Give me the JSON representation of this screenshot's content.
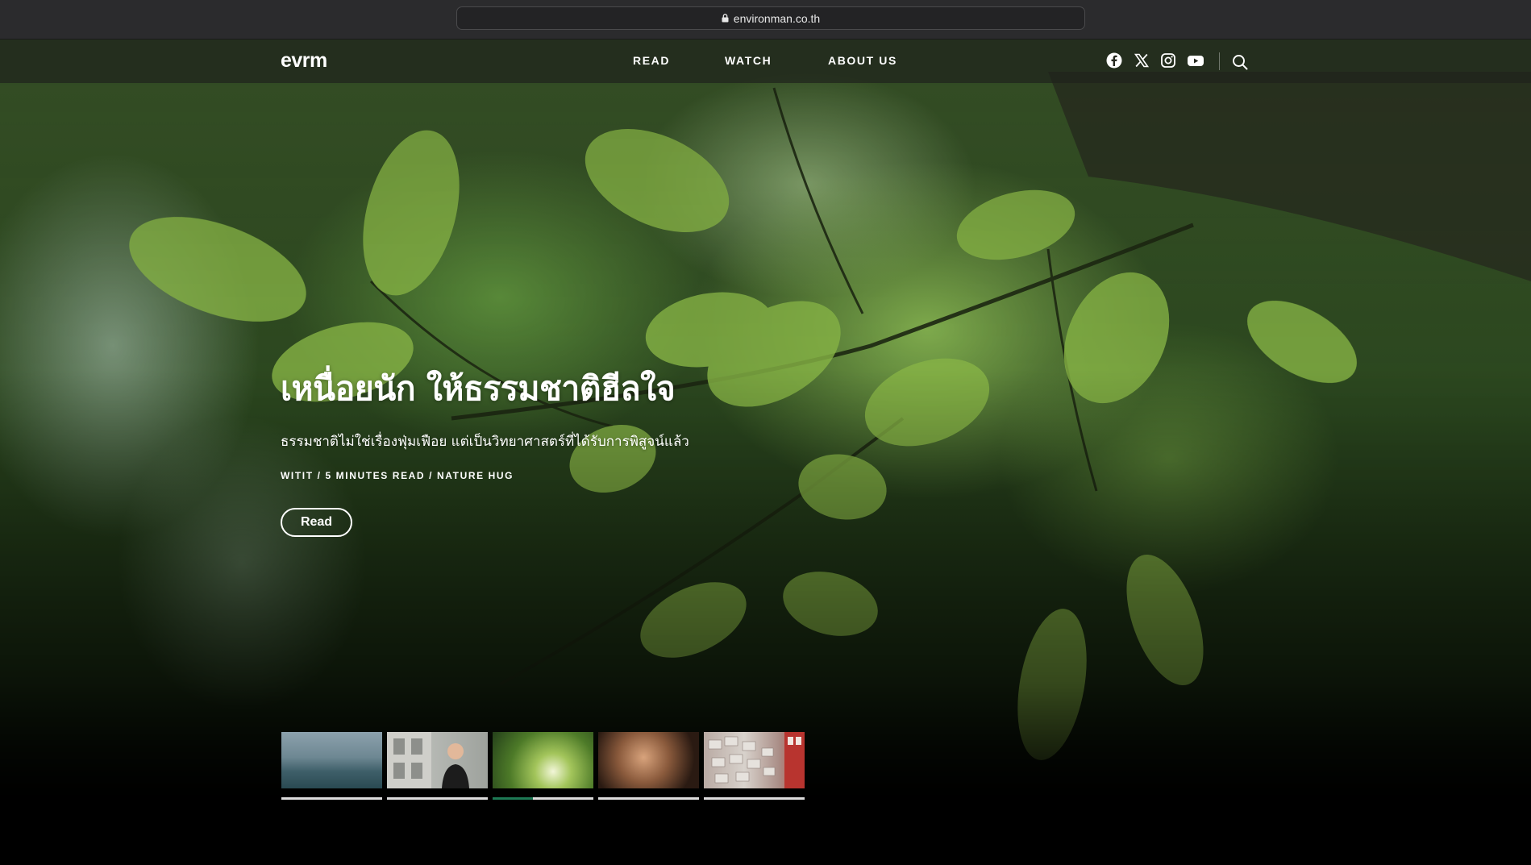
{
  "browser": {
    "url": "environman.co.th"
  },
  "nav": {
    "logo": "evrm",
    "links": [
      "READ",
      "WATCH",
      "ABOUT US"
    ],
    "social_icons": [
      "facebook-icon",
      "x-icon",
      "instagram-icon",
      "youtube-icon"
    ],
    "search_icon": "search-icon"
  },
  "hero": {
    "title": "เหนื่อยนัก ให้ธรรมชาติฮีลใจ",
    "subtitle": "ธรรมชาติไม่ใช่เรื่องฟุ่มเฟือย แต่เป็นวิทยาศาสตร์ที่ได้รับการพิสูจน์แล้ว",
    "meta": "WITIT / 5 MINUTES READ / NATURE HUG",
    "button_label": "Read"
  },
  "slides": {
    "active_index": 2,
    "active_progress": 0.4,
    "items": [
      {
        "image": "misty-forest"
      },
      {
        "image": "woman-in-front-of-building"
      },
      {
        "image": "green-leaves-canopy"
      },
      {
        "image": "elderly-woman-hugging-child"
      },
      {
        "image": "wall-of-air-conditioners"
      }
    ]
  },
  "colors": {
    "accent": "#1e7a55",
    "nav_bg": "#1e221c",
    "browser_bg": "#2b2b2d"
  }
}
